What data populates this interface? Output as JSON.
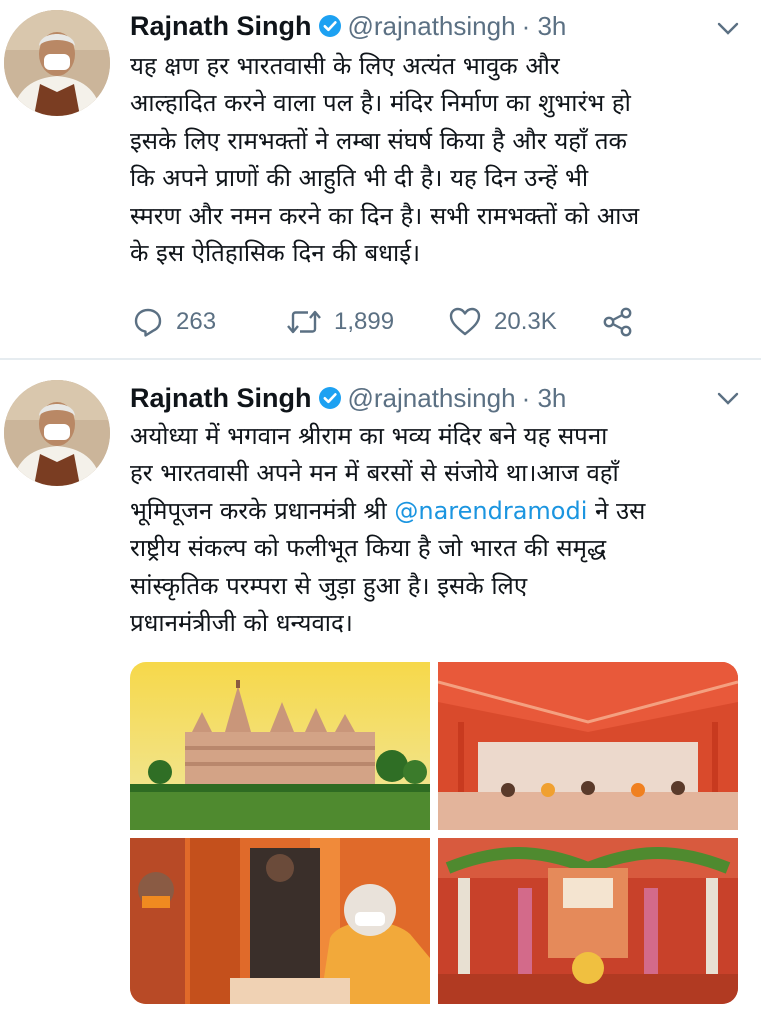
{
  "tweets": [
    {
      "author": "Rajnath Singh",
      "handle": "@rajnathsingh",
      "time": "· 3h",
      "lines": [
        "यह क्षण हर भारतवासी के लिए अत्यंत भावुक और",
        "आल्हादित करने वाला पल है। मंदिर निर्माण का शुभारंभ हो",
        "इसके लिए रामभक्तों ने लम्बा संघर्ष किया है और यहाँ तक",
        "कि अपने प्राणों की आहुति भी दी है। यह दिन उन्हें भी",
        "स्मरण और नमन करने का दिन है। सभी रामभक्तों को आज",
        "के इस ऐतिहासिक दिन की बधाई।"
      ],
      "replies": "263",
      "retweets": "1,899",
      "likes": "20.3K"
    },
    {
      "author": "Rajnath Singh",
      "handle": "@rajnathsingh",
      "time": "· 3h",
      "lines": [
        "अयोध्या में भगवान श्रीराम का भव्य मंदिर बने यह सपना",
        "हर भारतवासी अपने मन में बरसों से संजोये था।आज वहाँ",
        "",
        "राष्ट्रीय संकल्प को फलीभूत किया है जो भारत की समृद्ध",
        "सांस्कृतिक परम्परा से जुड़ा हुआ है। इसके लिए",
        "प्रधानमंत्रीजी को धन्यवाद।"
      ],
      "line3_before": "भूमिपूजन करके प्रधानमंत्री श्री ",
      "line3_mention": "@narendramodi",
      "line3_after": " ने उस",
      "images": [
        "temple-model-image",
        "canopy-hall-image",
        "leaders-image",
        "decorated-shrine-image"
      ]
    }
  ],
  "colors": {
    "text": "#0f1419",
    "secondary": "#5b7083",
    "verified": "#1da1f2",
    "link": "#1b95e0"
  }
}
